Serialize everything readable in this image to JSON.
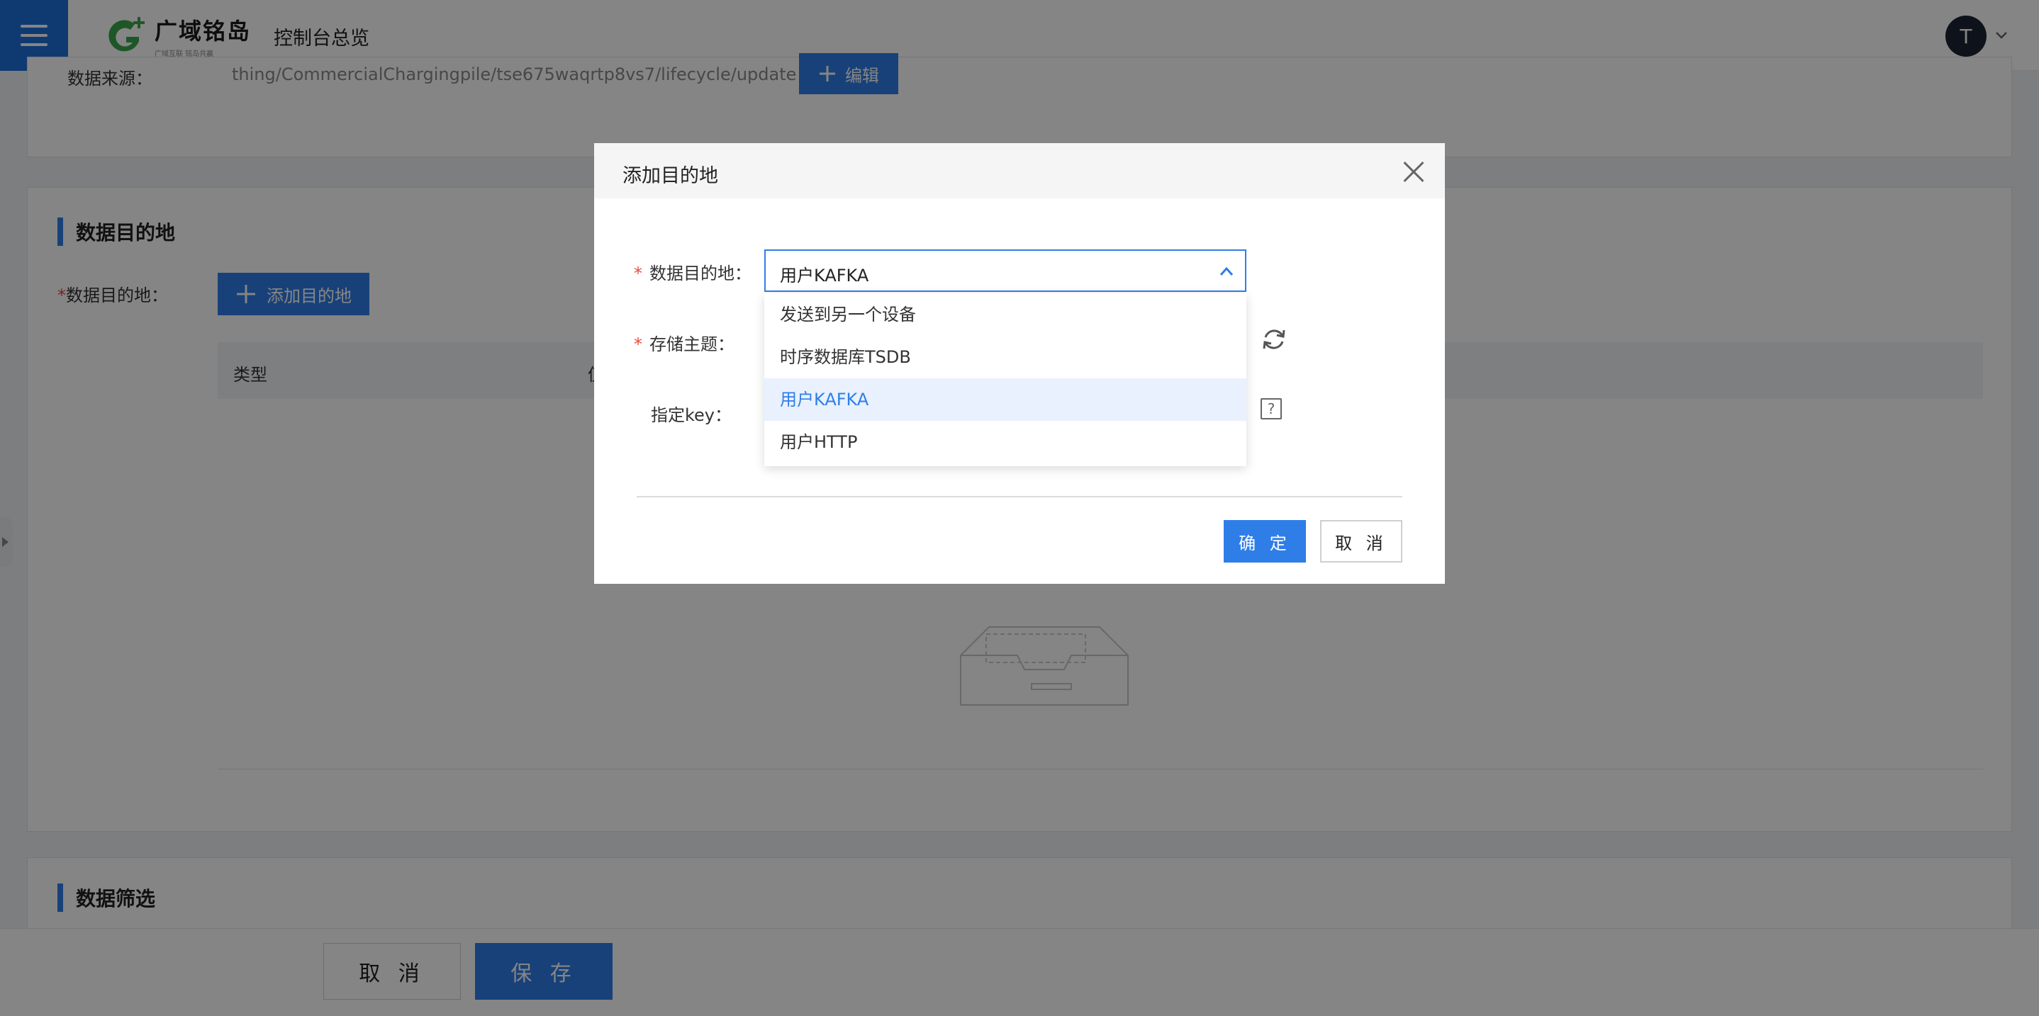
{
  "header": {
    "brand_name": "广域铭岛",
    "brand_slogan": "广域互联 铭岛共赢",
    "console_title": "控制台总览",
    "avatar_letter": "T"
  },
  "page": {
    "data_source_label": "数据来源：",
    "data_source_value": "thing/CommercialChargingpile/tse675waqrtp8vs7/lifecycle/update",
    "edit_label": "编辑",
    "dest_section_title": "数据目的地",
    "dest_field_label": "数据目的地：",
    "add_dest_label": "添加目的地",
    "table_headers": [
      "类型",
      "值"
    ],
    "filter_section_title": "数据筛选",
    "cancel_label": "取 消",
    "save_label": "保 存"
  },
  "modal": {
    "title": "添加目的地",
    "dest_label": "数据目的地：",
    "dest_selected": "用户KAFKA",
    "topic_label": "存储主题：",
    "key_label": "指定key：",
    "options": [
      "发送到另一个设备",
      "时序数据库TSDB",
      "用户KAFKA",
      "用户HTTP"
    ],
    "active_option": "用户KAFKA",
    "ok_label": "确 定",
    "cancel_label": "取 消"
  },
  "colors": {
    "primary": "#2f7ee8",
    "required": "#e64c3c",
    "brand_green": "#3aa84b"
  },
  "icons": [
    "menu-icon",
    "logo-icon",
    "chevron-down-icon",
    "plus-icon",
    "close-icon",
    "chevron-up-icon",
    "refresh-icon",
    "help-icon",
    "empty-box-icon"
  ]
}
